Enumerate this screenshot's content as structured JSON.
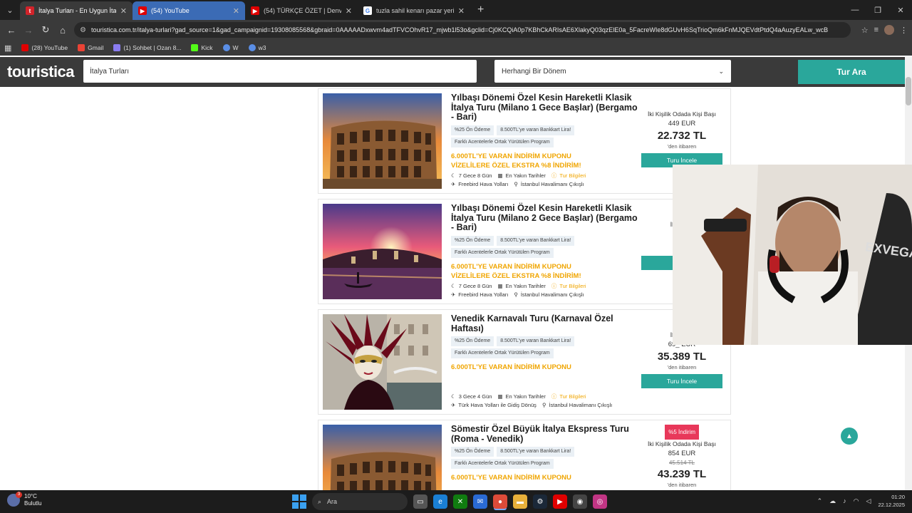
{
  "browser": {
    "tabs": [
      {
        "title": "İtalya Turları - En Uygun İtalya T",
        "fav_color": "#d2232a",
        "fav_text": "t"
      },
      {
        "title": "(54) YouTube",
        "fav_color": "#e00000",
        "fav_text": "▶"
      },
      {
        "title": "(54) TÜRKÇE ÖZET | Denver Nu",
        "fav_color": "#e00000",
        "fav_text": "▶"
      },
      {
        "title": "tuzla sahil kenarı pazar yeri - Go",
        "fav_color": "#ffffff",
        "fav_text": "G"
      }
    ],
    "url": "touristica.com.tr/italya-turlari?gad_source=1&gad_campaignid=19308085568&gbraid=0AAAAADxwvm4adTFVCOhvR17_mjwb1l53o&gclid=Cj0KCQiA0p7KBhCkARIsAE6XlakyQ03qzElE0a_5FacreWIe8dGUvH6SqTrioQm6kFnMJQEVdtPtdQ4aAuzyEALw_wcB",
    "bookmarks": [
      "(28) YouTube",
      "Gmail",
      "(1) Sohbet | Ozan 8...",
      "Kick",
      "W",
      "w3"
    ]
  },
  "site": {
    "logo": "touristica",
    "search_value": "İtalya Turları",
    "period_value": "Herhangi Bir Dönem",
    "search_button": "Tur Ara"
  },
  "tours": [
    {
      "title": "Yılbaşı Dönemi Özel Kesin Hareketli Klasik İtalya Turu (Milano 1 Gece Başlar) (Bergamo - Bari)",
      "tags": [
        "%25 Ön Ödeme",
        "8.500TL'ye varan Bankkart Lira!",
        "Farklı Acentelerle Ortak Yürütülen Program"
      ],
      "promo": [
        "6.000TL'YE VARAN İNDİRİM KUPONU",
        "VİZELİLERE ÖZEL EKSTRA %8 İNDİRİM!"
      ],
      "duration": "7 Gece 8 Gün",
      "dates": "En Yakın Tarihler",
      "info": "Tur Bilgileri",
      "airline": "Freebird Hava Yolları",
      "departure": "İstanbul Havalimanı Çıkışlı",
      "price_label": "İki Kişilik Odada Kişi Başı",
      "price_eur": "449 EUR",
      "price_tl": "22.732 TL",
      "from": "'den itibaren",
      "button": "Turu İncele"
    },
    {
      "title": "Yılbaşı Dönemi Özel Kesin Hareketli Klasik İtalya Turu (Milano 2 Gece Başlar) (Bergamo - Bari)",
      "tags": [
        "%25 Ön Ödeme",
        "8.500TL'ye varan Bankkart Lira!",
        "Farklı Acentelerle Ortak Yürütülen Program"
      ],
      "promo": [
        "6.000TL'YE VARAN İNDİRİM KUPONU",
        "VİZELİLERE ÖZEL EKSTRA %8 İNDİRİM!"
      ],
      "duration": "7 Gece 8 Gün",
      "dates": "En Yakın Tarihler",
      "info": "Tur Bilgileri",
      "airline": "Freebird Hava Yolları",
      "departure": "İstanbul Havalimanı Çıkışlı",
      "price_label": "İki Kişilik",
      "price_eur": "39",
      "price_tl": "20.",
      "from": "",
      "button": "Tu"
    },
    {
      "title": "Venedik Karnavalı Turu (Karnaval Özel Haftası)",
      "tags": [
        "%25 Ön Ödeme",
        "8.500TL'ye varan Bankkart Lira!",
        "Farklı Acentelerle Ortak Yürütülen Program"
      ],
      "promo": [
        "6.000TL'YE VARAN İNDİRİM KUPONU"
      ],
      "duration": "3 Gece 4 Gün",
      "dates": "En Yakın Tarihler",
      "info": "Tur Bilgileri",
      "airline": "Türk Hava Yolları ile Gidiş Dönüş",
      "departure": "İstanbul Havalimanı Çıkışlı",
      "price_label": "İki Kişilik",
      "price_eur": "69_ EUR",
      "price_tl": "35.389 TL",
      "from": "'den itibaren",
      "button": "Turu İncele"
    },
    {
      "title": "Sömestir Özel Büyük İtalya Ekspress Turu (Roma - Venedik)",
      "tags": [
        "%25 Ön Ödeme",
        "8.500TL'ye varan Bankkart Lira!",
        "Farklı Acentelerle Ortak Yürütülen Program"
      ],
      "promo": [
        "6.000TL'YE VARAN İNDİRİM KUPONU"
      ],
      "discount": "%5 İndirim",
      "price_label": "İki Kişilik Odada Kişi Başı",
      "price_eur": "854 EUR",
      "price_old": "45.514 TL",
      "price_tl": "43.239 TL",
      "from": "'den itibaren"
    }
  ],
  "taskbar": {
    "weather_temp": "10°C",
    "weather_desc": "Bulutlu",
    "weather_badge": "3",
    "search": "Ara",
    "time": "01:20",
    "date": "22.12.2025"
  }
}
